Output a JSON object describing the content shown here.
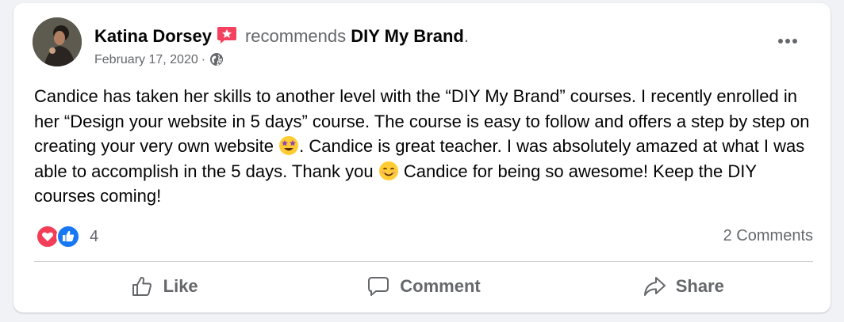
{
  "post": {
    "author": "Katina Dorsey",
    "verb": "recommends",
    "page_name": "DIY My Brand",
    "period": ".",
    "date": "February 17, 2020",
    "separator": "·",
    "audience_icon": "globe-icon",
    "badge_icon": "recommend-badge-icon",
    "text": {
      "part1": "Candice has taken her skills to another level with the “DIY My Brand” courses. I recently enrolled in her “Design your website in 5 days” course. The course is easy to follow and offers a step by step on creating your very own website ",
      "emoji1": "star-struck-emoji",
      "part2": ". Candice is great teacher. I was absolutely amazed at what I was able to accomplish in the 5 days. Thank you ",
      "emoji2": "smiling-face-emoji",
      "part3": " Candice for being so awesome! Keep the DIY courses coming!"
    }
  },
  "reactions": {
    "count": "4",
    "icons": [
      "love-reaction-icon",
      "like-reaction-icon"
    ],
    "comments_label": "2 Comments"
  },
  "actions": {
    "like_label": "Like",
    "comment_label": "Comment",
    "share_label": "Share"
  },
  "colors": {
    "page_bg": "#f0f2f5",
    "card_bg": "#ffffff",
    "secondary_text": "#65676b",
    "like_blue": "#1877f2",
    "love_red": "#f33e58",
    "badge_red": "#f3425f"
  }
}
